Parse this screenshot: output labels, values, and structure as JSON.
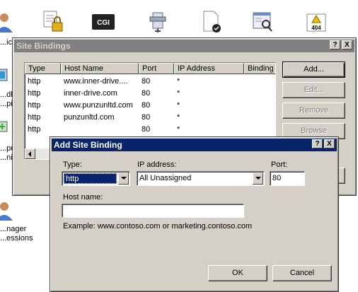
{
  "background": {
    "labels": [
      "...ical",
      "...dler",
      "...pings",
      "...put",
      "...ning",
      "...nager",
      "...essions"
    ],
    "icons": [
      "user-icon",
      "lock-document-icon",
      "cgi-icon",
      "compression-icon",
      "certificate-document-icon",
      "directory-browsing-icon",
      "error-404-icon"
    ],
    "cgi_text": "CGI",
    "err_text": "404"
  },
  "site_bindings": {
    "title": "Site Bindings",
    "help": "?",
    "close": "X",
    "columns": [
      "Type",
      "Host Name",
      "Port",
      "IP Address",
      "Binding"
    ],
    "rows": [
      {
        "type": "http",
        "host": "www.inner-drive....",
        "port": "80",
        "ip": "*"
      },
      {
        "type": "http",
        "host": "inner-drive.com",
        "port": "80",
        "ip": "*"
      },
      {
        "type": "http",
        "host": "www.punzunltd.com",
        "port": "80",
        "ip": "*"
      },
      {
        "type": "http",
        "host": "punzunltd.com",
        "port": "80",
        "ip": "*"
      },
      {
        "type": "http",
        "host": "",
        "port": "80",
        "ip": "*"
      }
    ],
    "buttons": {
      "add": "Add...",
      "edit": "Edit...",
      "remove": "Remove",
      "browse": "Browse"
    }
  },
  "add_binding": {
    "title": "Add Site Binding",
    "help": "?",
    "close": "X",
    "type_label": "Type:",
    "type_value": "http",
    "ip_label": "IP address:",
    "ip_value": "All Unassigned",
    "port_label": "Port:",
    "port_value": "80",
    "host_label": "Host name:",
    "host_value": "",
    "example": "Example: www.contoso.com or marketing.contoso.com",
    "ok": "OK",
    "cancel": "Cancel"
  }
}
